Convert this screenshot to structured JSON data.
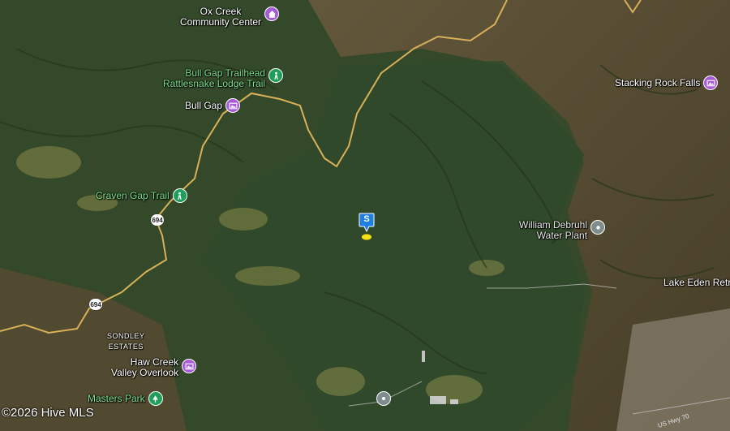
{
  "map": {
    "pois": [
      {
        "name": "Ox Creek Community Center",
        "label": "Ox Creek\nCommunity Center",
        "line1": "Ox Creek",
        "line2": "Community Center",
        "type": "community",
        "color": "#a55bd6"
      },
      {
        "name": "Bull Gap Trailhead Rattlesnake Lodge Trail",
        "line1": "Bull Gap Trailhead",
        "line2": "Rattlesnake Lodge Trail",
        "type": "trail",
        "color": "#1e9e5a"
      },
      {
        "name": "Bull Gap",
        "line1": "Bull Gap",
        "type": "scenic",
        "color": "#a55bd6"
      },
      {
        "name": "Craven Gap Trail",
        "line1": "Craven Gap Trail",
        "type": "trail",
        "color": "#1e9e5a"
      },
      {
        "name": "Stacking Rock Falls",
        "line1": "Stacking Rock Falls",
        "type": "scenic",
        "color": "#a55bd6"
      },
      {
        "name": "William Debruhl Water Plant",
        "line1": "William Debruhl",
        "line2": "Water Plant",
        "type": "place",
        "color": "#7f8c8d"
      },
      {
        "name": "Lake Eden Retreat",
        "line1": "Lake Eden Retreat",
        "type": "place-label"
      },
      {
        "name": "Haw Creek Valley Overlook",
        "line1": "Haw Creek",
        "line2": "Valley Overlook",
        "type": "scenic",
        "color": "#a55bd6"
      },
      {
        "name": "Masters Park",
        "line1": "Masters Park",
        "type": "park",
        "color": "#1e9e5a"
      },
      {
        "name": "Sondley Estates",
        "line1": "SONDLEY",
        "line2": "ESTATES",
        "type": "area"
      }
    ],
    "route_shields": [
      "694",
      "694"
    ],
    "subject_marker": "S",
    "road_label": "US Hwy 70",
    "copyright": "©2026 Hive MLS"
  }
}
